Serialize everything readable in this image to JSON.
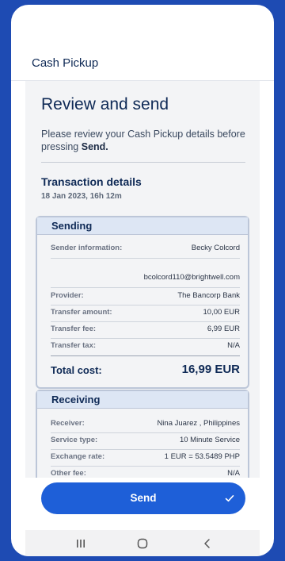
{
  "app_title": "Cash Pickup",
  "page": {
    "heading": "Review and send",
    "lead_text": "Please review your Cash Pickup details before pressing",
    "lead_bold": "Send."
  },
  "transaction": {
    "title": "Transaction details",
    "date": "18 Jan 2023, 16h 12m"
  },
  "sending": {
    "header": "Sending",
    "sender_label": "Sender information:",
    "sender_name": "Becky Colcord",
    "sender_email": "bcolcord110@brightwell.com",
    "rows": [
      {
        "label": "Provider:",
        "value": "The Bancorp Bank"
      },
      {
        "label": "Transfer amount:",
        "value": "10,00 EUR"
      },
      {
        "label": "Transfer fee:",
        "value": "6,99 EUR"
      },
      {
        "label": "Transfer tax:",
        "value": "N/A"
      }
    ],
    "total_label": "Total cost:",
    "total_value": "16,99 EUR"
  },
  "receiving": {
    "header": "Receiving",
    "rows": [
      {
        "label": "Receiver:",
        "value": "Nina  Juarez , Philippines"
      },
      {
        "label": "Service type:",
        "value": "10 Minute Service"
      },
      {
        "label": "Exchange rate:",
        "value": "1 EUR = 53.5489 PHP"
      },
      {
        "label": "Other fee:",
        "value": "N/A"
      }
    ]
  },
  "send_button": {
    "label": "Send",
    "icon": "check-icon"
  },
  "nav": {
    "icons": [
      "recent-apps-icon",
      "home-icon",
      "back-icon"
    ]
  },
  "colors": {
    "background": "#1e4bb3",
    "primary": "#1e5fd8",
    "heading": "#0f2a56"
  }
}
